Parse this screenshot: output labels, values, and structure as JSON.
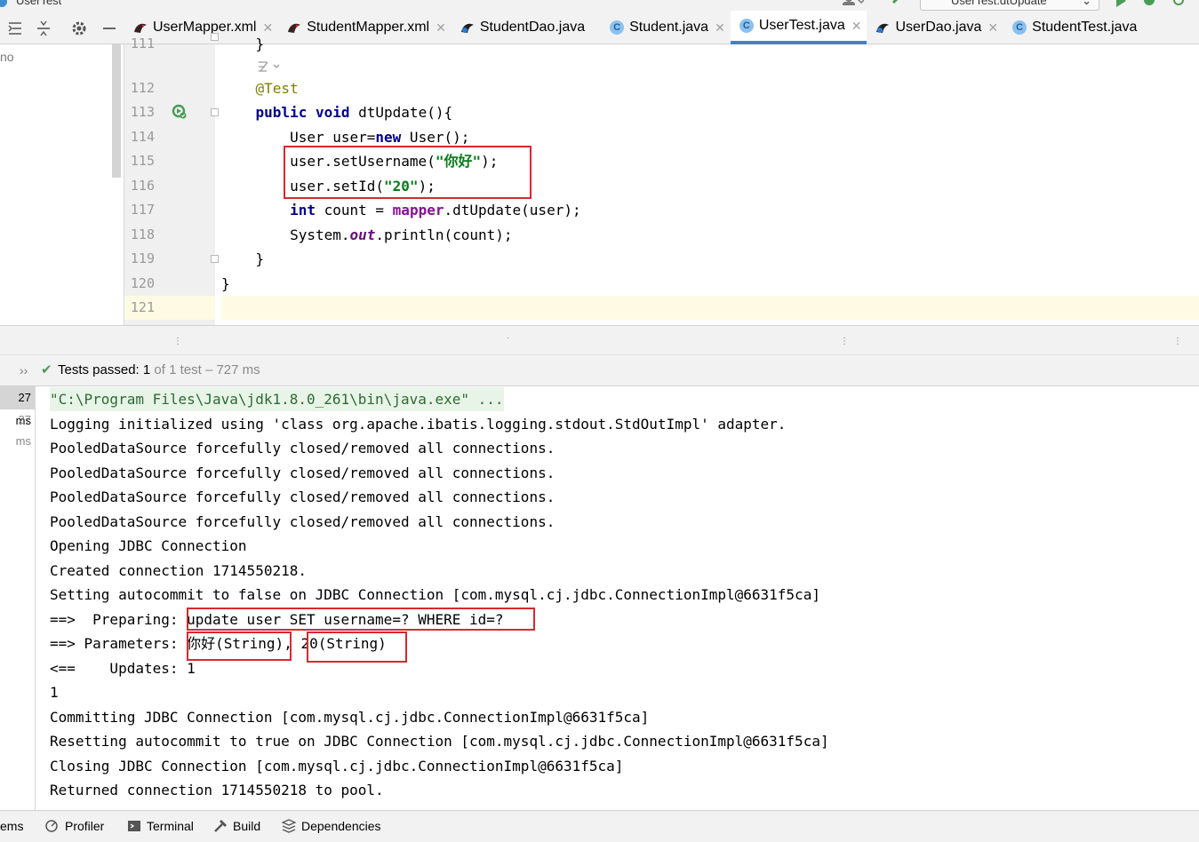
{
  "window": {
    "title": "UserTest",
    "run_config": "UserTest.dtUpdate"
  },
  "tabs": [
    {
      "label": "UserMapper.xml",
      "kind": "xml",
      "closable": true,
      "active": false
    },
    {
      "label": "StudentMapper.xml",
      "kind": "xml",
      "closable": true,
      "active": false
    },
    {
      "label": "StudentDao.java",
      "kind": "mapper",
      "closable": false,
      "active": false
    },
    {
      "label": "Student.java",
      "kind": "class",
      "closable": true,
      "active": false
    },
    {
      "label": "UserTest.java",
      "kind": "test",
      "closable": true,
      "active": true
    },
    {
      "label": "UserDao.java",
      "kind": "mapper",
      "closable": true,
      "active": false
    },
    {
      "label": "StudentTest.java",
      "kind": "test",
      "closable": false,
      "active": false
    }
  ],
  "project_panel": {
    "partial_label": "no"
  },
  "editor": {
    "lines": [
      {
        "num": "111",
        "tokens": [
          [
            "    }",
            ""
          ]
        ]
      },
      {
        "num": "",
        "tokens": []
      },
      {
        "num": "112",
        "tokens": [
          [
            "    ",
            ""
          ],
          [
            "@Test",
            "ann"
          ]
        ]
      },
      {
        "num": "113",
        "tokens": [
          [
            "    ",
            ""
          ],
          [
            "public",
            "kw"
          ],
          [
            " ",
            ""
          ],
          [
            "void",
            "kw"
          ],
          [
            " dtUpdate(){",
            ""
          ]
        ]
      },
      {
        "num": "114",
        "tokens": [
          [
            "        User user=",
            ""
          ],
          [
            "new",
            "kw"
          ],
          [
            " User();",
            ""
          ]
        ]
      },
      {
        "num": "115",
        "tokens": [
          [
            "        user.setUsername(",
            ""
          ],
          [
            "\"你好\"",
            "str"
          ],
          [
            ");",
            ""
          ]
        ]
      },
      {
        "num": "116",
        "tokens": [
          [
            "        user.setId(",
            ""
          ],
          [
            "\"20\"",
            "str"
          ],
          [
            ");",
            ""
          ]
        ]
      },
      {
        "num": "117",
        "tokens": [
          [
            "        ",
            ""
          ],
          [
            "int",
            "kw"
          ],
          [
            " count = ",
            ""
          ],
          [
            "mapper",
            "field"
          ],
          [
            ".dtUpdate(user);",
            ""
          ]
        ]
      },
      {
        "num": "118",
        "tokens": [
          [
            "        System.",
            ""
          ],
          [
            "out",
            "static"
          ],
          [
            ".println(count);",
            ""
          ]
        ]
      },
      {
        "num": "119",
        "tokens": [
          [
            "    }",
            ""
          ]
        ]
      },
      {
        "num": "120",
        "tokens": [
          [
            "}",
            ""
          ]
        ]
      },
      {
        "num": "121",
        "tokens": []
      }
    ]
  },
  "test_results": {
    "status_prefix": "Tests passed:",
    "passed": "1",
    "rest": "of 1 test – 727 ms",
    "tree_times": [
      "27 ms",
      "27 ms"
    ]
  },
  "console": {
    "lines": [
      "\"C:\\Program Files\\Java\\jdk1.8.0_261\\bin\\java.exe\" ...",
      "Logging initialized using 'class org.apache.ibatis.logging.stdout.StdOutImpl' adapter.",
      "PooledDataSource forcefully closed/removed all connections.",
      "PooledDataSource forcefully closed/removed all connections.",
      "PooledDataSource forcefully closed/removed all connections.",
      "PooledDataSource forcefully closed/removed all connections.",
      "Opening JDBC Connection",
      "Created connection 1714550218.",
      "Setting autocommit to false on JDBC Connection [com.mysql.cj.jdbc.ConnectionImpl@6631f5ca]",
      "==>  Preparing: update user SET username=? WHERE id=?",
      "==> Parameters: 你好(String), 20(String)",
      "<==    Updates: 1",
      "1",
      "Committing JDBC Connection [com.mysql.cj.jdbc.ConnectionImpl@6631f5ca]",
      "Resetting autocommit to true on JDBC Connection [com.mysql.cj.jdbc.ConnectionImpl@6631f5ca]",
      "Closing JDBC Connection [com.mysql.cj.jdbc.ConnectionImpl@6631f5ca]",
      "Returned connection 1714550218 to pool."
    ]
  },
  "bottom_tabs": [
    {
      "label": "ems",
      "icon": ""
    },
    {
      "label": "Profiler",
      "icon": "profiler-icon"
    },
    {
      "label": "Terminal",
      "icon": "terminal-icon"
    },
    {
      "label": "Build",
      "icon": "build-icon"
    },
    {
      "label": "Dependencies",
      "icon": "dependencies-icon"
    }
  ],
  "colors": {
    "highlight_box": "#d9282f",
    "accent": "#4083c9",
    "pass_green": "#499c54",
    "keyword": "#00008a",
    "string": "#067d17",
    "annotation": "#808000"
  }
}
